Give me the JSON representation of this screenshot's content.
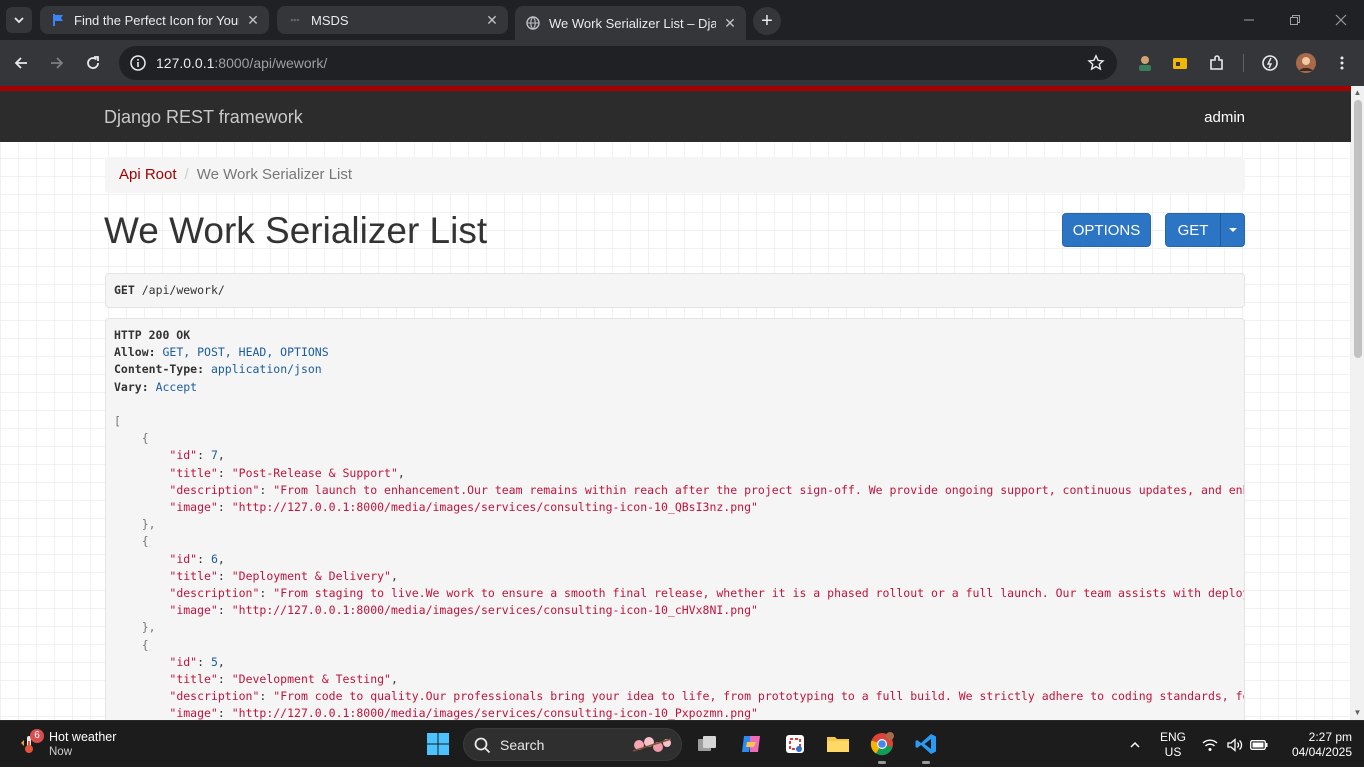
{
  "browser": {
    "tabs": [
      {
        "title": "Find the Perfect Icon for Your Pr",
        "favicon": "flag-icon"
      },
      {
        "title": "MSDS",
        "favicon": "loading-icon"
      },
      {
        "title": "We Work Serializer List – Djang",
        "favicon": "globe-icon",
        "active": true
      }
    ],
    "url_host": "127.0.0.1",
    "url_path": ":8000/api/wework/"
  },
  "page": {
    "brand": "Django REST framework",
    "user": "admin",
    "breadcrumb": {
      "root": "Api Root",
      "separator": "/",
      "current": "We Work Serializer List"
    },
    "title": "We Work Serializer List",
    "buttons": {
      "options": "OPTIONS",
      "get": "GET"
    },
    "request": {
      "method": "GET",
      "path": "/api/wework/"
    },
    "response": {
      "status": "HTTP 200 OK",
      "headers": [
        {
          "key": "Allow:",
          "value": "GET, POST, HEAD, OPTIONS"
        },
        {
          "key": "Content-Type:",
          "value": "application/json"
        },
        {
          "key": "Vary:",
          "value": "Accept"
        }
      ],
      "open_bracket": "[",
      "items": [
        {
          "id": "7",
          "title": "\"Post-Release & Support\"",
          "description": "\"From launch to enhancement.Our team remains within reach after the project sign-off. We provide ongoing support, continuous updates, and enhancement",
          "image": "\"http://127.0.0.1:8000/media/images/services/consulting-icon-10_QBsI3nz.png\""
        },
        {
          "id": "6",
          "title": "\"Deployment & Delivery\"",
          "description": "\"From staging to live.We work to ensure a smooth final release, whether it is a phased rollout or a full launch. Our team assists with deployment, co",
          "image": "\"http://127.0.0.1:8000/media/images/services/consulting-icon-10_cHVx8NI.png\""
        },
        {
          "id": "5",
          "title": "\"Development & Testing\"",
          "description": "\"From code to quality.Our professionals bring your idea to life, from prototyping to a full build. We strictly adhere to coding standards, follow qua",
          "image": "\"http://127.0.0.1:8000/media/images/services/consulting-icon-10_Pxpozmn.png\""
        }
      ]
    }
  },
  "taskbar": {
    "weather_title": "Hot weather",
    "weather_sub": "Now",
    "weather_badge": "6",
    "search_label": "Search",
    "lang_top": "ENG",
    "lang_bottom": "US",
    "time": "2:27 pm",
    "date": "04/04/2025"
  },
  "colors": {
    "accent_red": "#a30000",
    "button_blue": "#2c75c4",
    "navbar": "#2c2c2c"
  }
}
